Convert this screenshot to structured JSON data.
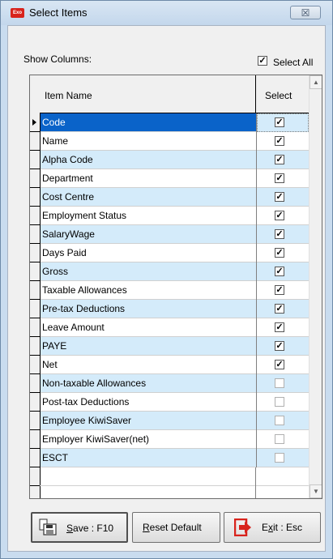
{
  "window": {
    "title": "Select Items",
    "app_icon_text": "Exo",
    "close_glyph": "☒"
  },
  "show_columns_label": "Show Columns:",
  "select_all": {
    "label": "Select All",
    "checked": true
  },
  "grid": {
    "headers": {
      "item_name": "Item Name",
      "select": "Select"
    },
    "rows": [
      {
        "name": "Code",
        "checked": true
      },
      {
        "name": "Name",
        "checked": true
      },
      {
        "name": "Alpha Code",
        "checked": true
      },
      {
        "name": "Department",
        "checked": true
      },
      {
        "name": "Cost Centre",
        "checked": true
      },
      {
        "name": "Employment Status",
        "checked": true
      },
      {
        "name": "SalaryWage",
        "checked": true
      },
      {
        "name": "Days Paid",
        "checked": true
      },
      {
        "name": "Gross",
        "checked": true
      },
      {
        "name": "Taxable Allowances",
        "checked": true
      },
      {
        "name": "Pre-tax Deductions",
        "checked": true
      },
      {
        "name": "Leave Amount",
        "checked": true
      },
      {
        "name": "PAYE",
        "checked": true
      },
      {
        "name": "Net",
        "checked": true
      },
      {
        "name": "Non-taxable Allowances",
        "checked": false
      },
      {
        "name": "Post-tax Deductions",
        "checked": false
      },
      {
        "name": "Employee KiwiSaver",
        "checked": false
      },
      {
        "name": "Employer KiwiSaver(net)",
        "checked": false
      },
      {
        "name": "ESCT",
        "checked": false
      }
    ],
    "selected_index": 0
  },
  "buttons": {
    "save": "Save : F10",
    "reset": "Reset Default",
    "exit": "Exit : Esc"
  },
  "colors": {
    "row_alt": "#d4ebfa",
    "row_selected": "#0a63c9",
    "exit_icon": "#d8231c"
  }
}
